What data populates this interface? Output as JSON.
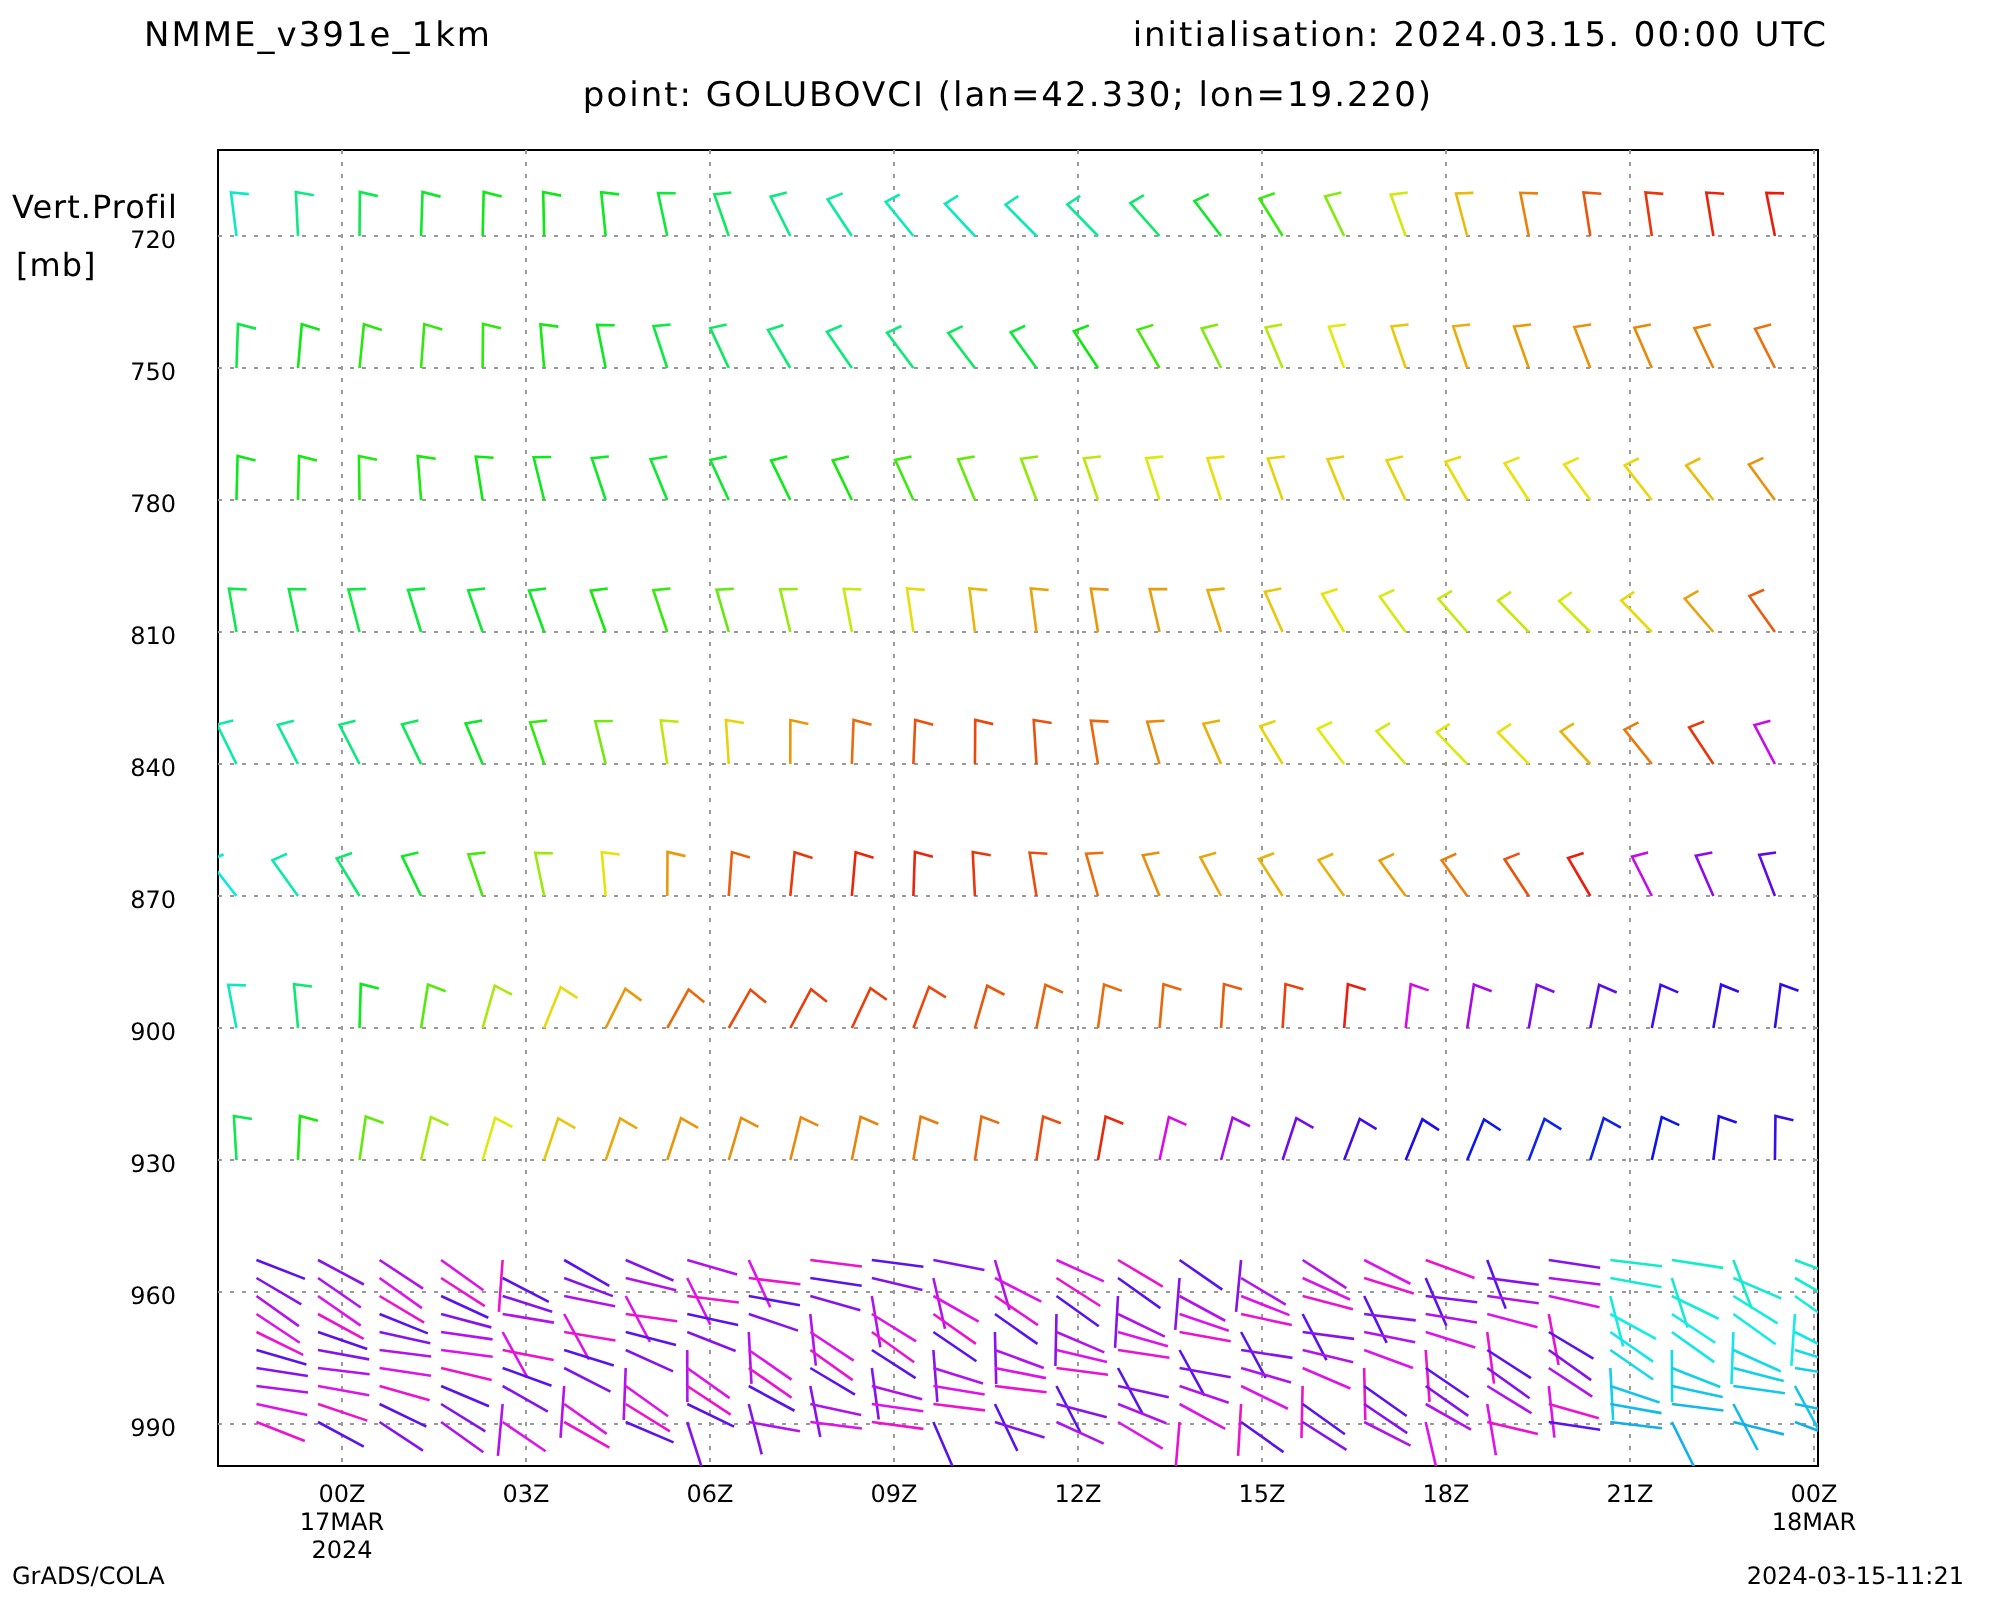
{
  "header": {
    "model": "NMME_v391e_1km",
    "initialisation": "initialisation: 2024.03.15. 00:00 UTC",
    "point": "point: GOLUBOVCI (lan=42.330; lon=19.220)"
  },
  "y_axis": {
    "title_lines": [
      "Vert.Profil",
      "[mb]"
    ],
    "ticks": [
      "720",
      "750",
      "780",
      "810",
      "840",
      "870",
      "900",
      "930",
      "960",
      "990"
    ]
  },
  "x_axis": {
    "ticks": [
      {
        "lines": [
          "00Z",
          "17MAR",
          "2024"
        ]
      },
      {
        "lines": [
          "03Z"
        ]
      },
      {
        "lines": [
          "06Z"
        ]
      },
      {
        "lines": [
          "09Z"
        ]
      },
      {
        "lines": [
          "12Z"
        ]
      },
      {
        "lines": [
          "15Z"
        ]
      },
      {
        "lines": [
          "18Z"
        ]
      },
      {
        "lines": [
          "21Z"
        ]
      },
      {
        "lines": [
          "00Z",
          "18MAR"
        ]
      }
    ]
  },
  "footer": {
    "left": "GrADS/COLA",
    "right": "2024-03-15-11:21"
  }
}
